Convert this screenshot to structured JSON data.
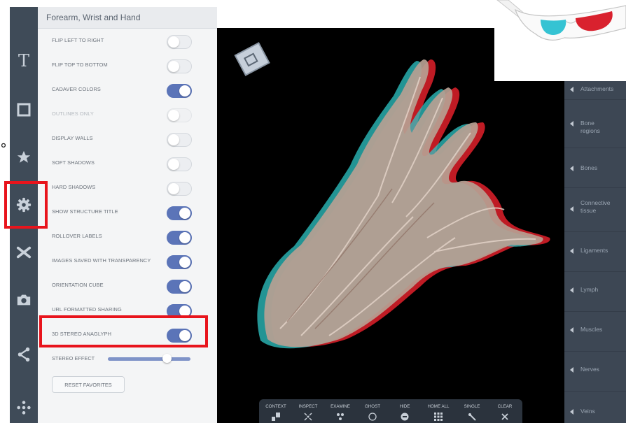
{
  "panel": {
    "title": "Forearm, Wrist and Hand",
    "settings": [
      {
        "label": "FLIP LEFT TO RIGHT",
        "on": false,
        "disabled": false
      },
      {
        "label": "FLIP TOP TO BOTTOM",
        "on": false,
        "disabled": false
      },
      {
        "label": "CADAVER COLORS",
        "on": true,
        "disabled": false
      },
      {
        "label": "OUTLINES ONLY",
        "on": false,
        "disabled": true
      },
      {
        "label": "DISPLAY WALLS",
        "on": false,
        "disabled": false
      },
      {
        "label": "SOFT SHADOWS",
        "on": false,
        "disabled": false
      },
      {
        "label": "HARD SHADOWS",
        "on": false,
        "disabled": false
      },
      {
        "label": "SHOW STRUCTURE TITLE",
        "on": true,
        "disabled": false
      },
      {
        "label": "ROLLOVER LABELS",
        "on": true,
        "disabled": false
      },
      {
        "label": "IMAGES SAVED WITH TRANSPARENCY",
        "on": true,
        "disabled": false
      },
      {
        "label": "ORIENTATION CUBE",
        "on": true,
        "disabled": false
      },
      {
        "label": "URL FORMATTED SHARING",
        "on": true,
        "disabled": false
      },
      {
        "label": "3D STEREO ANAGLYPH",
        "on": true,
        "disabled": false
      }
    ],
    "stereo_effect": {
      "label": "STEREO EFFECT",
      "value": 0.72
    },
    "reset_label": "RESET FAVORITES"
  },
  "left_tools": [
    {
      "icon": "text-icon",
      "glyph": "T"
    },
    {
      "icon": "square-icon"
    },
    {
      "icon": "star-icon"
    },
    {
      "icon": "gear-icon"
    },
    {
      "icon": "scissors-icon"
    },
    {
      "icon": "camera-icon"
    },
    {
      "icon": "share-icon"
    },
    {
      "icon": "move-icon"
    }
  ],
  "right_layers": [
    "Attachments",
    "Bone regions",
    "Bones",
    "Connective tissue",
    "Ligaments",
    "Lymph",
    "Muscles",
    "Nerves",
    "Veins"
  ],
  "bottom_tools": [
    "CONTEXT",
    "INSPECT",
    "EXAMINE",
    "GHOST",
    "HIDE",
    "HOME ALL",
    "SINGLE",
    "CLEAR"
  ],
  "stray_mark": "°",
  "colors": {
    "toolbar": "#3f4b58",
    "toggle_on": "#5b74b8",
    "highlight": "#e8141c",
    "anaglyph_red": "#e0202a",
    "anaglyph_cyan": "#2fc6c6"
  }
}
